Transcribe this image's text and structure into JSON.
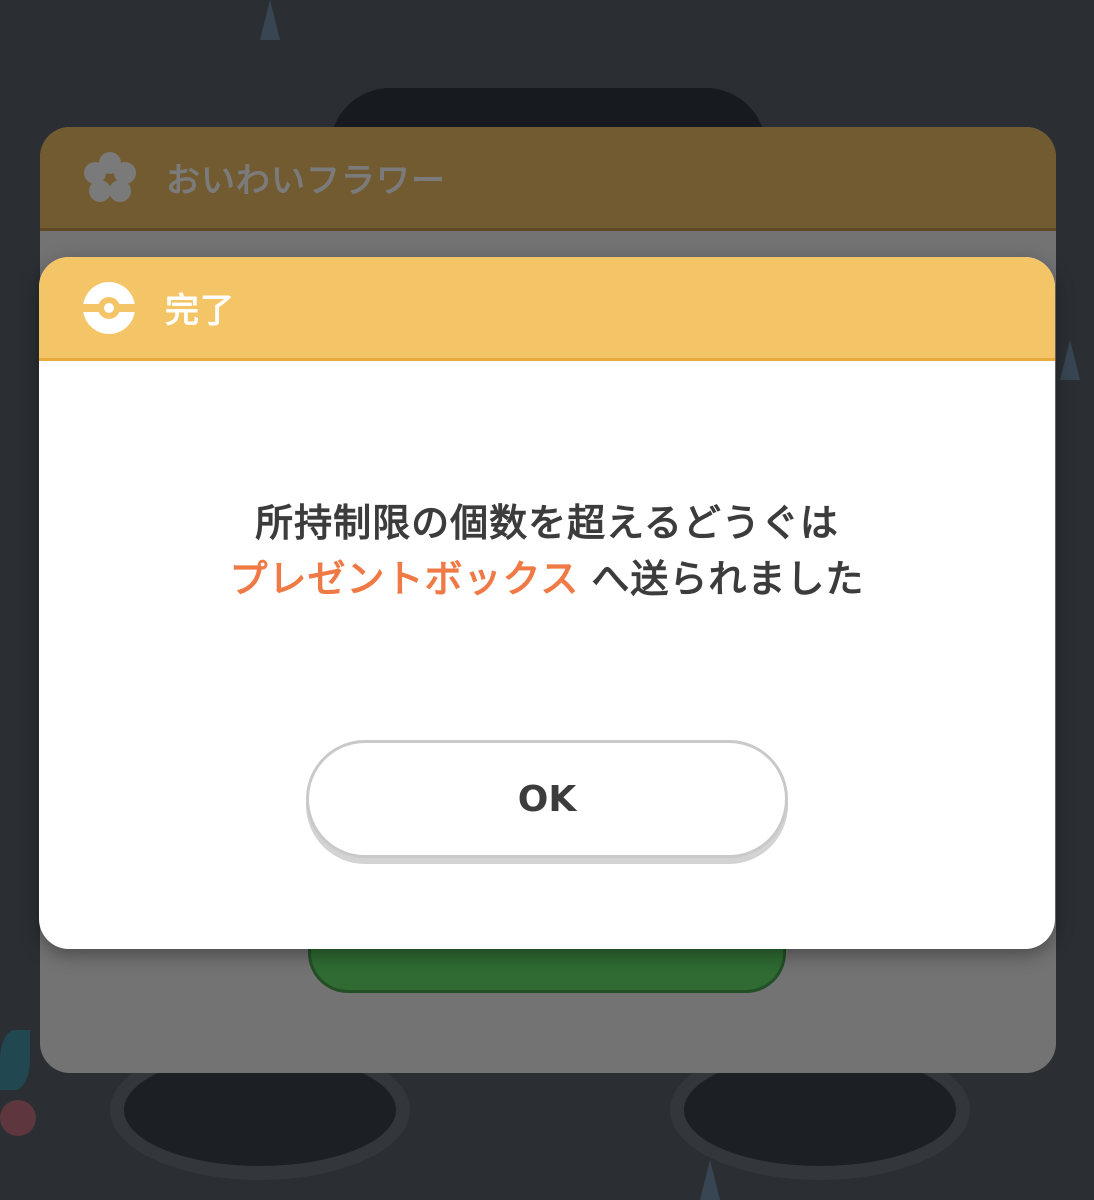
{
  "background_panel": {
    "title": "おいわいフラワー",
    "header_icon": "flower-icon"
  },
  "dialog": {
    "title": "完了",
    "header_icon": "pokeball-icon",
    "message_line1": "所持制限の個数を超えるどうぐは",
    "message_link": "プレゼントボックス",
    "message_line2_rest": "へ送られました",
    "ok_button": "OK"
  },
  "colors": {
    "dialog_header": "#f4c566",
    "highlight_text": "#ef7a45",
    "back_header": "#725b30",
    "overlay_background": "#2b2f33"
  }
}
